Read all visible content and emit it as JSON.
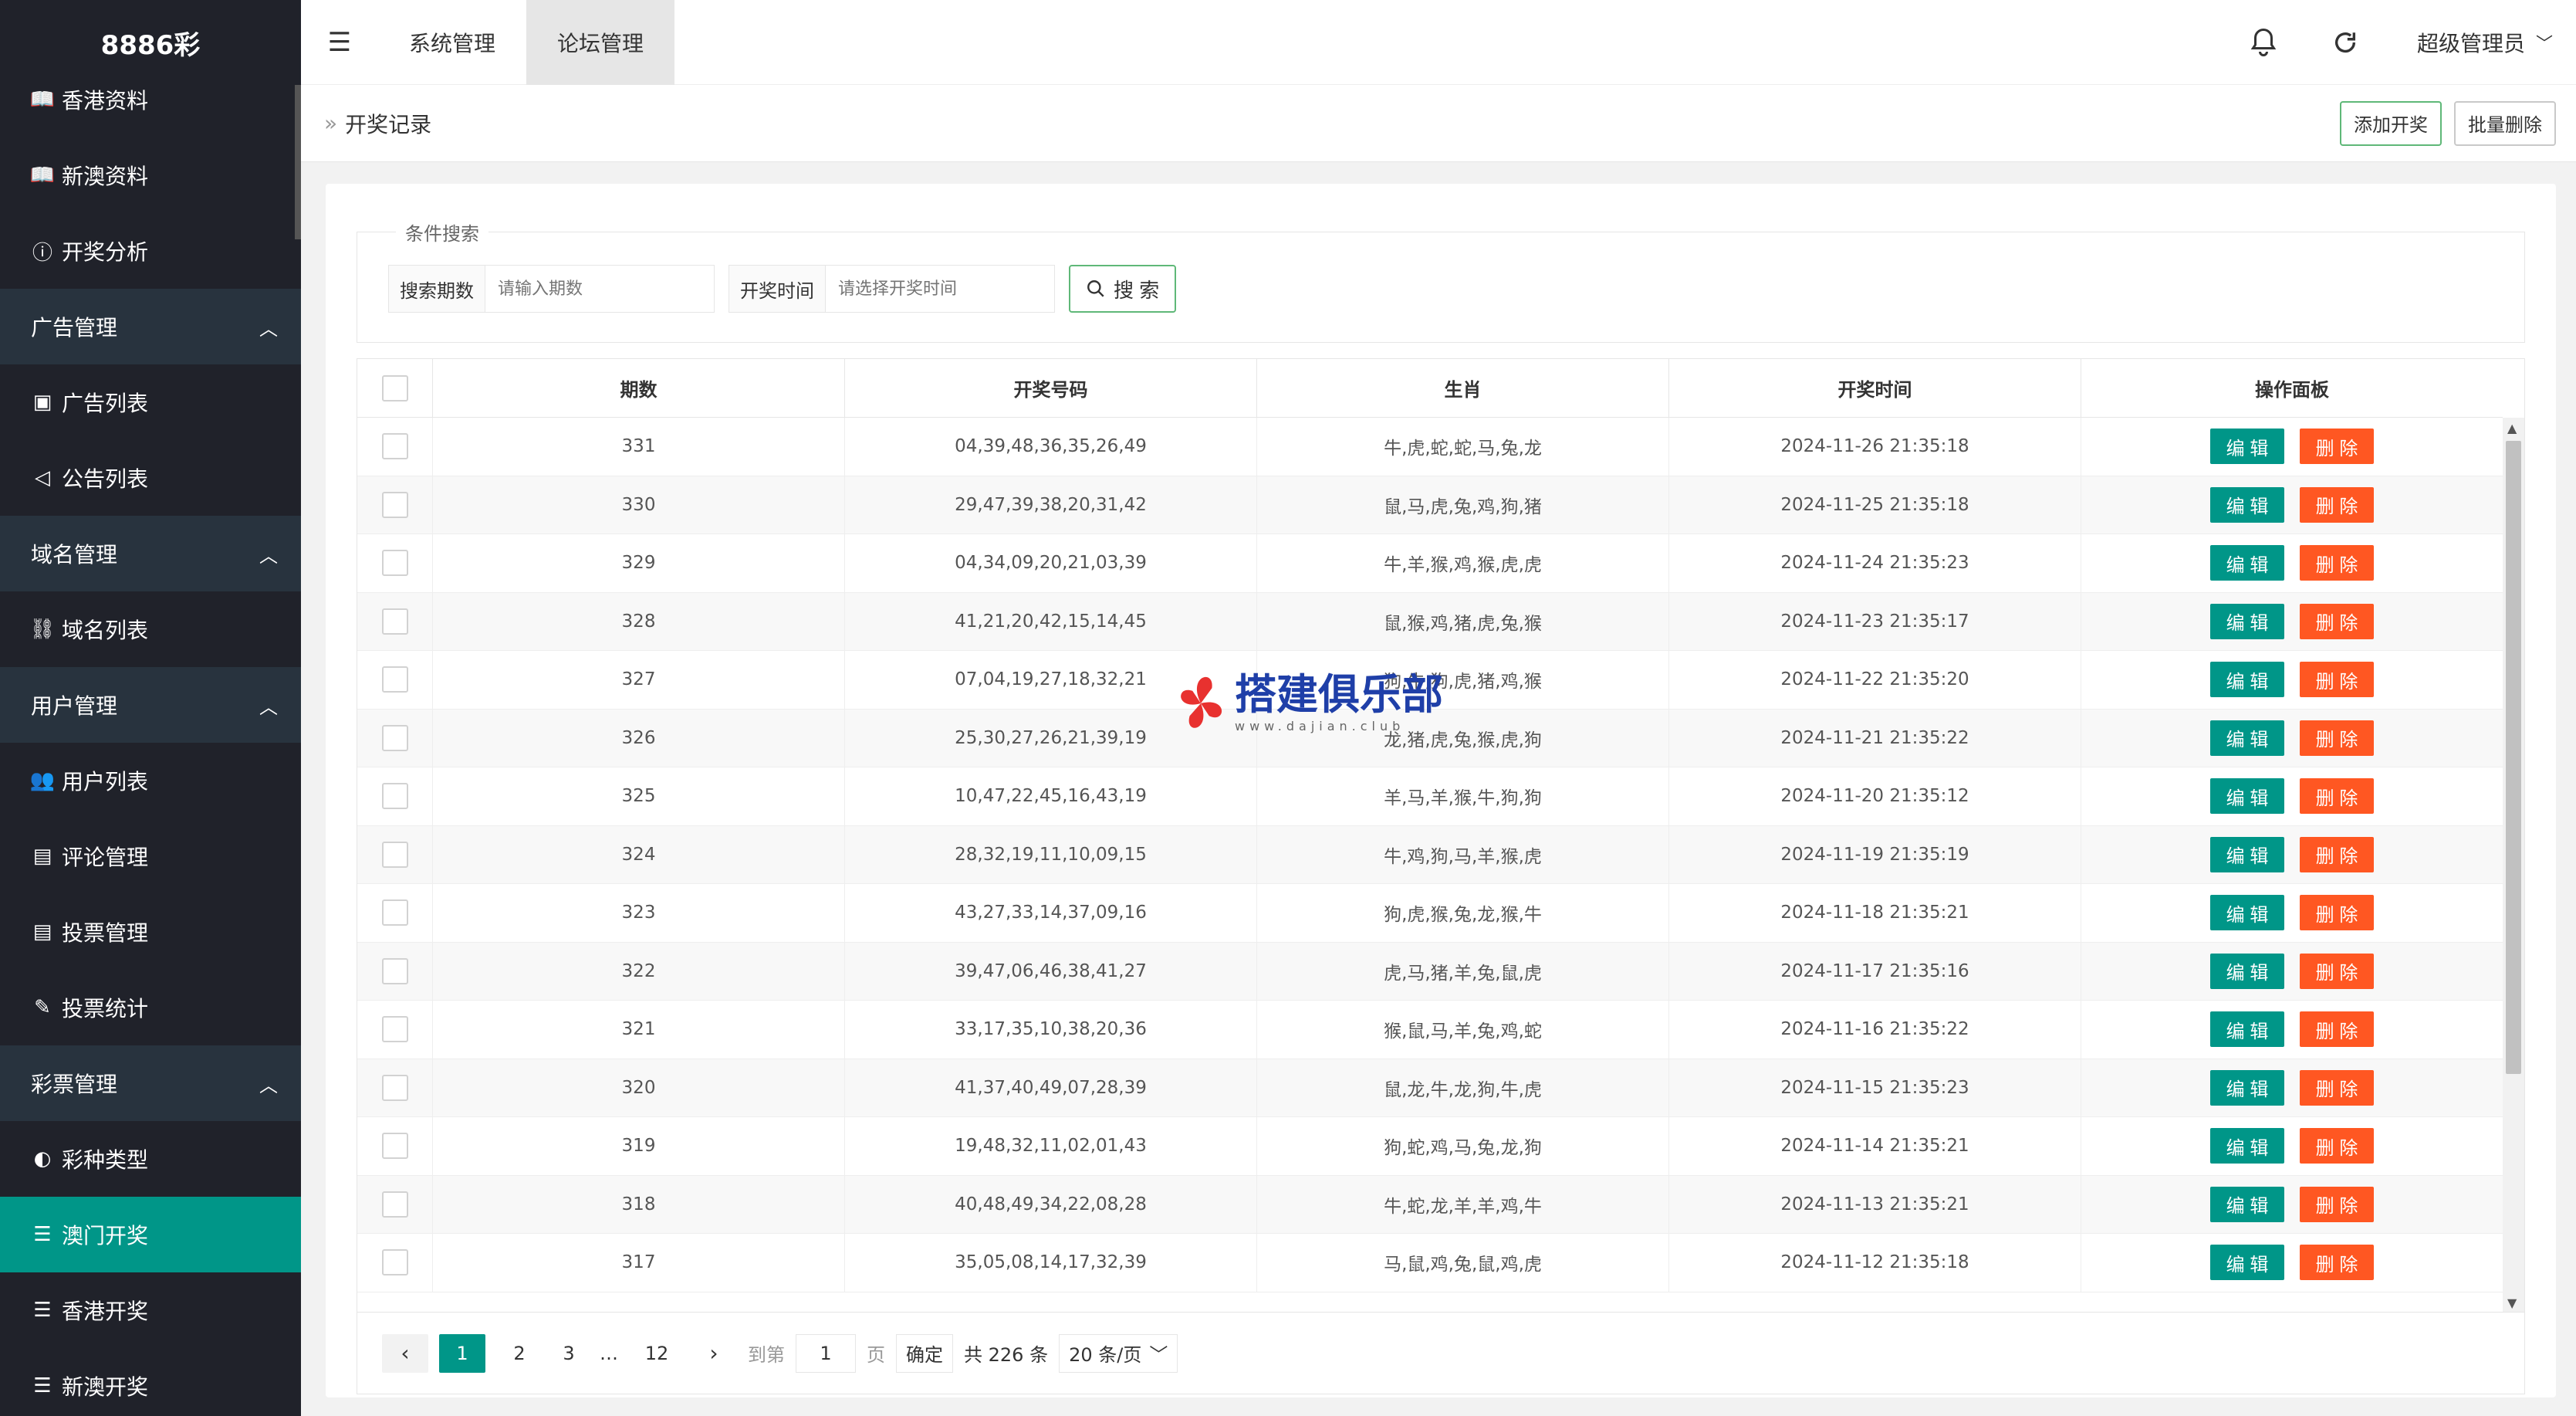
{
  "app": {
    "logo": "8886彩"
  },
  "sidebar": {
    "items": [
      {
        "label": "香港资料",
        "type": "sub",
        "icon": "book-icon"
      },
      {
        "label": "新澳资料",
        "type": "sub",
        "icon": "book-icon"
      },
      {
        "label": "开奖分析",
        "type": "sub",
        "icon": "help-circle-icon"
      },
      {
        "label": "广告管理",
        "type": "group"
      },
      {
        "label": "广告列表",
        "type": "sub",
        "icon": "image-icon"
      },
      {
        "label": "公告列表",
        "type": "sub",
        "icon": "speaker-icon"
      },
      {
        "label": "域名管理",
        "type": "group"
      },
      {
        "label": "域名列表",
        "type": "sub",
        "icon": "link-icon"
      },
      {
        "label": "用户管理",
        "type": "group"
      },
      {
        "label": "用户列表",
        "type": "sub",
        "icon": "users-icon"
      },
      {
        "label": "评论管理",
        "type": "sub",
        "icon": "document-icon"
      },
      {
        "label": "投票管理",
        "type": "sub",
        "icon": "document-icon"
      },
      {
        "label": "投票统计",
        "type": "sub",
        "icon": "edit-doc-icon"
      },
      {
        "label": "彩票管理",
        "type": "group"
      },
      {
        "label": "彩种类型",
        "type": "sub",
        "icon": "palette-icon"
      },
      {
        "label": "澳门开奖",
        "type": "sub",
        "icon": "list-icon",
        "active": true
      },
      {
        "label": "香港开奖",
        "type": "sub",
        "icon": "list-icon"
      },
      {
        "label": "新澳开奖",
        "type": "sub",
        "icon": "list-icon"
      }
    ]
  },
  "topbar": {
    "tabs": [
      {
        "label": "系统管理"
      },
      {
        "label": "论坛管理",
        "active": true
      }
    ],
    "user": "超级管理员"
  },
  "breadcrumb": {
    "current": "开奖记录",
    "add_btn": "添加开奖",
    "batch_delete_btn": "批量删除"
  },
  "search": {
    "legend": "条件搜索",
    "period_label": "搜索期数",
    "period_placeholder": "请输入期数",
    "time_label": "开奖时间",
    "time_placeholder": "请选择开奖时间",
    "button": "搜 索"
  },
  "table": {
    "columns": [
      "期数",
      "开奖号码",
      "生肖",
      "开奖时间",
      "操作面板"
    ],
    "edit_label": "编 辑",
    "delete_label": "删 除",
    "rows": [
      {
        "period": "331",
        "numbers": "04,39,48,36,35,26,49",
        "zodiac": "牛,虎,蛇,蛇,马,兔,龙",
        "time": "2024-11-26 21:35:18"
      },
      {
        "period": "330",
        "numbers": "29,47,39,38,20,31,42",
        "zodiac": "鼠,马,虎,兔,鸡,狗,猪",
        "time": "2024-11-25 21:35:18"
      },
      {
        "period": "329",
        "numbers": "04,34,09,20,21,03,39",
        "zodiac": "牛,羊,猴,鸡,猴,虎,虎",
        "time": "2024-11-24 21:35:23"
      },
      {
        "period": "328",
        "numbers": "41,21,20,42,15,14,45",
        "zodiac": "鼠,猴,鸡,猪,虎,兔,猴",
        "time": "2024-11-23 21:35:17"
      },
      {
        "period": "327",
        "numbers": "07,04,19,27,18,32,21",
        "zodiac": "狗,牛,狗,虎,猪,鸡,猴",
        "time": "2024-11-22 21:35:20"
      },
      {
        "period": "326",
        "numbers": "25,30,27,26,21,39,19",
        "zodiac": "龙,猪,虎,兔,猴,虎,狗",
        "time": "2024-11-21 21:35:22"
      },
      {
        "period": "325",
        "numbers": "10,47,22,45,16,43,19",
        "zodiac": "羊,马,羊,猴,牛,狗,狗",
        "time": "2024-11-20 21:35:12"
      },
      {
        "period": "324",
        "numbers": "28,32,19,11,10,09,15",
        "zodiac": "牛,鸡,狗,马,羊,猴,虎",
        "time": "2024-11-19 21:35:19"
      },
      {
        "period": "323",
        "numbers": "43,27,33,14,37,09,16",
        "zodiac": "狗,虎,猴,兔,龙,猴,牛",
        "time": "2024-11-18 21:35:21"
      },
      {
        "period": "322",
        "numbers": "39,47,06,46,38,41,27",
        "zodiac": "虎,马,猪,羊,兔,鼠,虎",
        "time": "2024-11-17 21:35:16"
      },
      {
        "period": "321",
        "numbers": "33,17,35,10,38,20,36",
        "zodiac": "猴,鼠,马,羊,兔,鸡,蛇",
        "time": "2024-11-16 21:35:22"
      },
      {
        "period": "320",
        "numbers": "41,37,40,49,07,28,39",
        "zodiac": "鼠,龙,牛,龙,狗,牛,虎",
        "time": "2024-11-15 21:35:23"
      },
      {
        "period": "319",
        "numbers": "19,48,32,11,02,01,43",
        "zodiac": "狗,蛇,鸡,马,兔,龙,狗",
        "time": "2024-11-14 21:35:21"
      },
      {
        "period": "318",
        "numbers": "40,48,49,34,22,08,28",
        "zodiac": "牛,蛇,龙,羊,羊,鸡,牛",
        "time": "2024-11-13 21:35:21"
      },
      {
        "period": "317",
        "numbers": "35,05,08,14,17,32,39",
        "zodiac": "马,鼠,鸡,兔,鼠,鸡,虎",
        "time": "2024-11-12 21:35:18"
      }
    ]
  },
  "pager": {
    "pages": [
      "1",
      "2",
      "3",
      "…",
      "12"
    ],
    "goto_label": "到第",
    "goto_value": "1",
    "page_unit": "页",
    "confirm": "确定",
    "total": "共 226 条",
    "page_size": "20 条/页"
  },
  "watermark": {
    "title": "搭建俱乐部",
    "url": "www.dajian.club"
  }
}
